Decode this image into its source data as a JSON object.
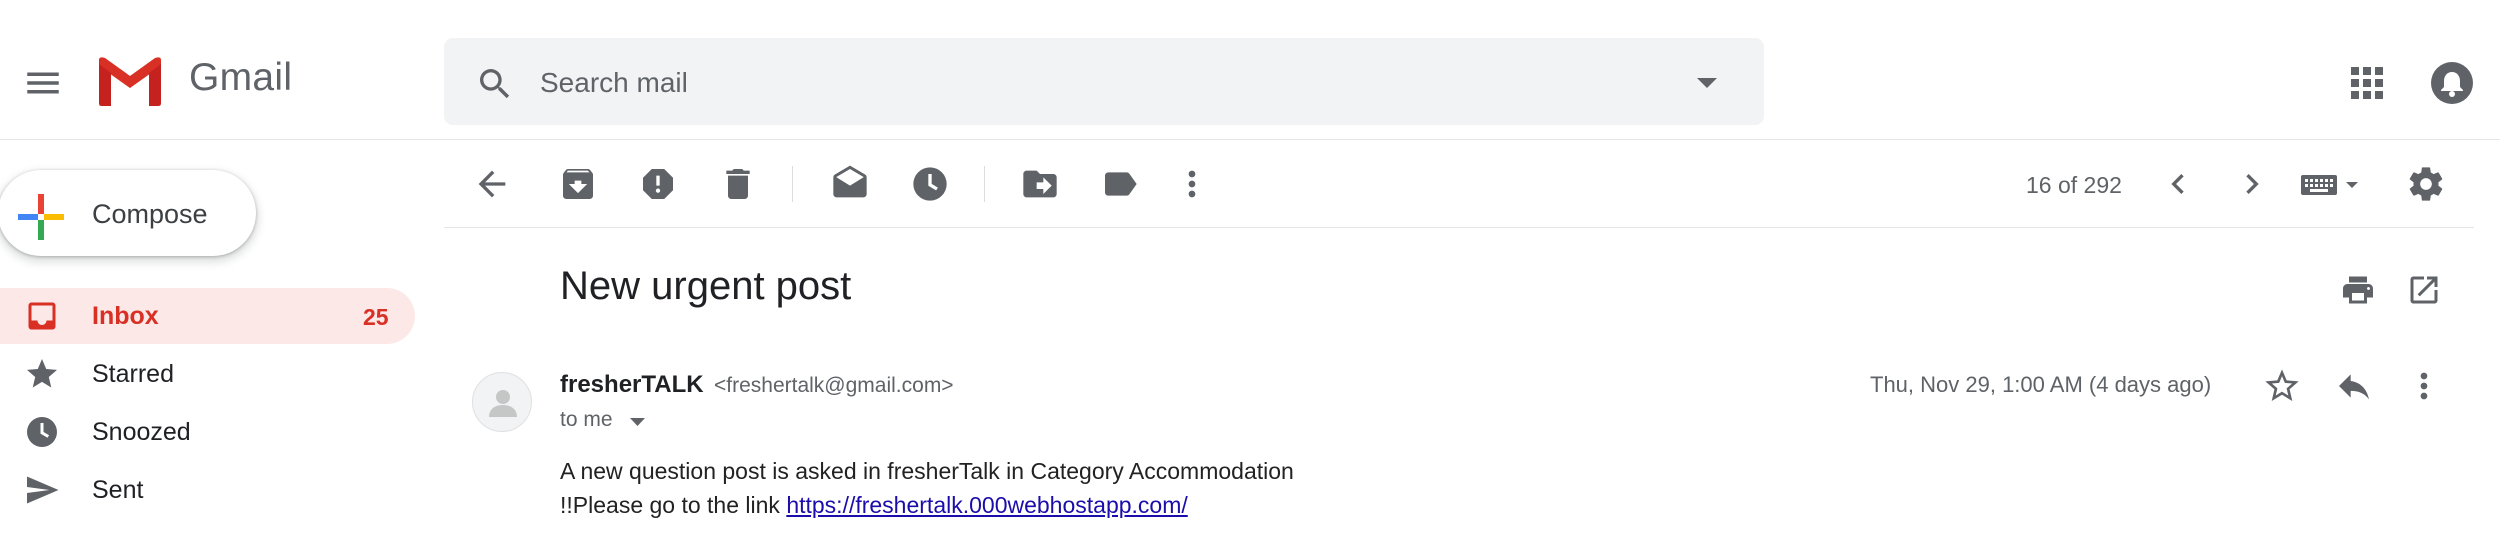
{
  "header": {
    "app_name": "Gmail",
    "search_placeholder": "Search mail"
  },
  "sidebar": {
    "compose_label": "Compose",
    "items": [
      {
        "id": "inbox",
        "label": "Inbox",
        "count": "25",
        "icon": "inbox-icon",
        "selected": true
      },
      {
        "id": "starred",
        "label": "Starred",
        "icon": "star-icon"
      },
      {
        "id": "snoozed",
        "label": "Snoozed",
        "icon": "clock-icon"
      },
      {
        "id": "sent",
        "label": "Sent",
        "icon": "send-icon"
      }
    ]
  },
  "toolbar": {
    "buttons": [
      "back-icon",
      "archive-icon",
      "report-spam-icon",
      "delete-icon",
      "mark-unread-icon",
      "snooze-icon",
      "move-to-icon",
      "labels-icon",
      "more-vert-icon"
    ],
    "pager": "16 of 292"
  },
  "message": {
    "subject": "New urgent post",
    "sender_name": "fresherTALK",
    "sender_email": "<freshertalk@gmail.com>",
    "recipient": "to me",
    "date": "Thu, Nov 29, 1:00 AM (4 days ago)",
    "body_line1": "A new question post is asked in fresherTalk in Category Accommodation",
    "body_line2_prefix": "!!Please go to the link",
    "body_link": "https://freshertalk.000webhostapp.com/"
  },
  "colors": {
    "accent_red": "#d93025",
    "selected_bg": "#fce8e6",
    "link": "#1a0dab",
    "icon_gray": "#5f6368"
  }
}
